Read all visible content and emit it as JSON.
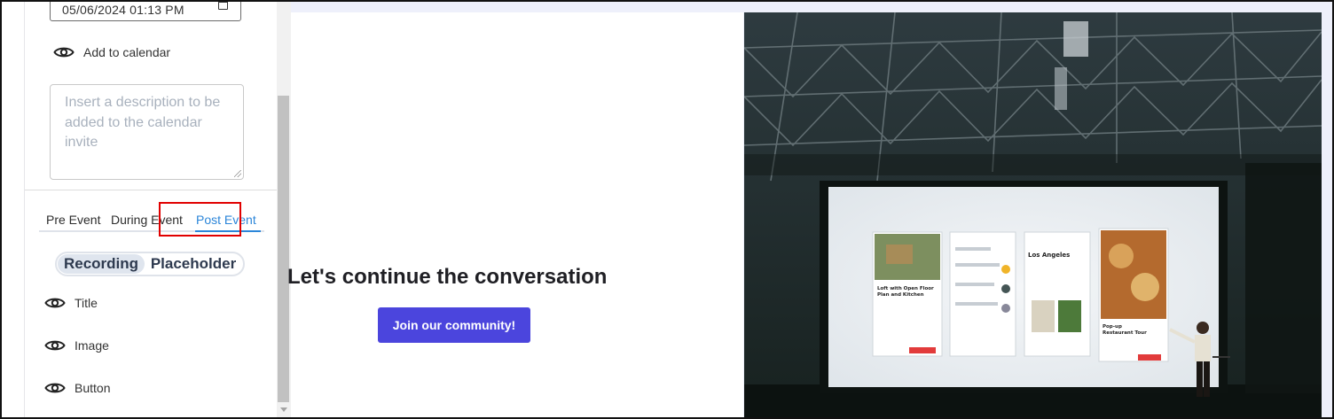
{
  "sidebar": {
    "datetime_value": "05/06/2024 01:13 PM",
    "add_to_calendar_label": "Add to calendar",
    "description_placeholder": "Insert a description to be added to the calendar invite",
    "tabs": [
      {
        "label": "Pre Event",
        "active": false
      },
      {
        "label": "During Event",
        "active": false
      },
      {
        "label": "Post Event",
        "active": true
      }
    ],
    "segmented": {
      "selected": "Recording",
      "other": "Placeholder"
    },
    "toggles": [
      {
        "label": "Title",
        "icon": "eye-icon"
      },
      {
        "label": "Image",
        "icon": "eye-icon"
      },
      {
        "label": "Button",
        "icon": "eye-icon"
      }
    ]
  },
  "preview": {
    "headline": "Let's continue the conversation",
    "cta_label": "Join our community!",
    "image_alt": "Speaker presenting an app design on a large screen in a warehouse venue"
  },
  "colors": {
    "accent_tab": "#2c86d9",
    "cta_background": "#4b45dd",
    "highlight": "#e10000",
    "preview_background": "#eef0fb"
  },
  "image_description": {
    "visible_text": {
      "preview_card_left": [
        "Loft with Open Floor Plan and Kitchen"
      ],
      "preview_card_middle": [
        "Los Angeles"
      ],
      "preview_card_right": [
        "Pop-up Restaurant Tour"
      ]
    }
  }
}
